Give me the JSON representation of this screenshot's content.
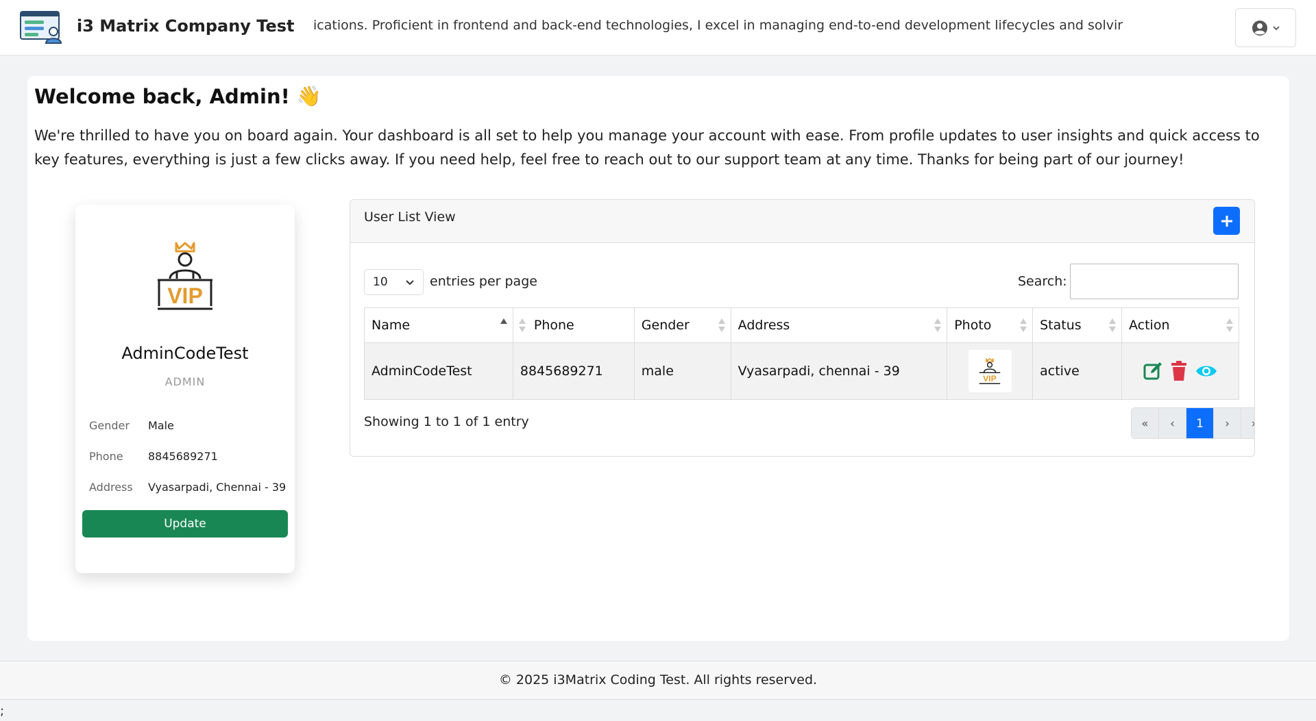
{
  "navbar": {
    "brand_name": "i3 Matrix Company Test",
    "marquee_text": "ying scalable web applications. Proficient in frontend and back-end technologies, I excel in managing end-to-end development lifecycles and solvir",
    "user_icon": "user-circle-icon",
    "caret_icon": "chevron-down-icon"
  },
  "welcome": {
    "title": "Welcome back, Admin!",
    "emoji": "👋",
    "text": "We're thrilled to have you on board again. Your dashboard is all set to help you manage your account with ease. From profile updates to user insights and quick access to key features, everything is just a few clicks away. If you need help, feel free to reach out to our support team at any time. Thanks for being part of our journey!"
  },
  "profile": {
    "photo_label": "VIP",
    "name": "AdminCodeTest",
    "role": "ADMIN",
    "gender_label": "Gender",
    "gender": "Male",
    "phone_label": "Phone",
    "phone": "8845689271",
    "address_label": "Address",
    "address": "Vyasarpadi, Chennai - 39",
    "update_label": "Update"
  },
  "user_list": {
    "title": "User List View",
    "add_icon": "plus-icon",
    "entries_value": "10",
    "entries_label": "entries per page",
    "search_label": "Search:",
    "search_value": "",
    "columns": [
      "Name",
      "Phone",
      "Gender",
      "Address",
      "Photo",
      "Status",
      "Action"
    ],
    "rows": [
      {
        "name": "AdminCodeTest",
        "phone": "8845689271",
        "gender": "male",
        "address": "Vyasarpadi, chennai - 39",
        "photo_label": "VIP",
        "status": "active"
      }
    ],
    "showing": "Showing 1 to 1 of 1 entry",
    "pager": [
      "«",
      "‹",
      "1",
      "›",
      "»"
    ],
    "active_page": "1"
  },
  "footer": {
    "text": "© 2025 i3Matrix Coding Test. All rights reserved."
  },
  "stray_text": ";",
  "colors": {
    "primary": "#0d6efd",
    "success": "#198754",
    "danger": "#dc3545",
    "info": "#0dcaf0",
    "vip_gold": "#e39b2e"
  }
}
